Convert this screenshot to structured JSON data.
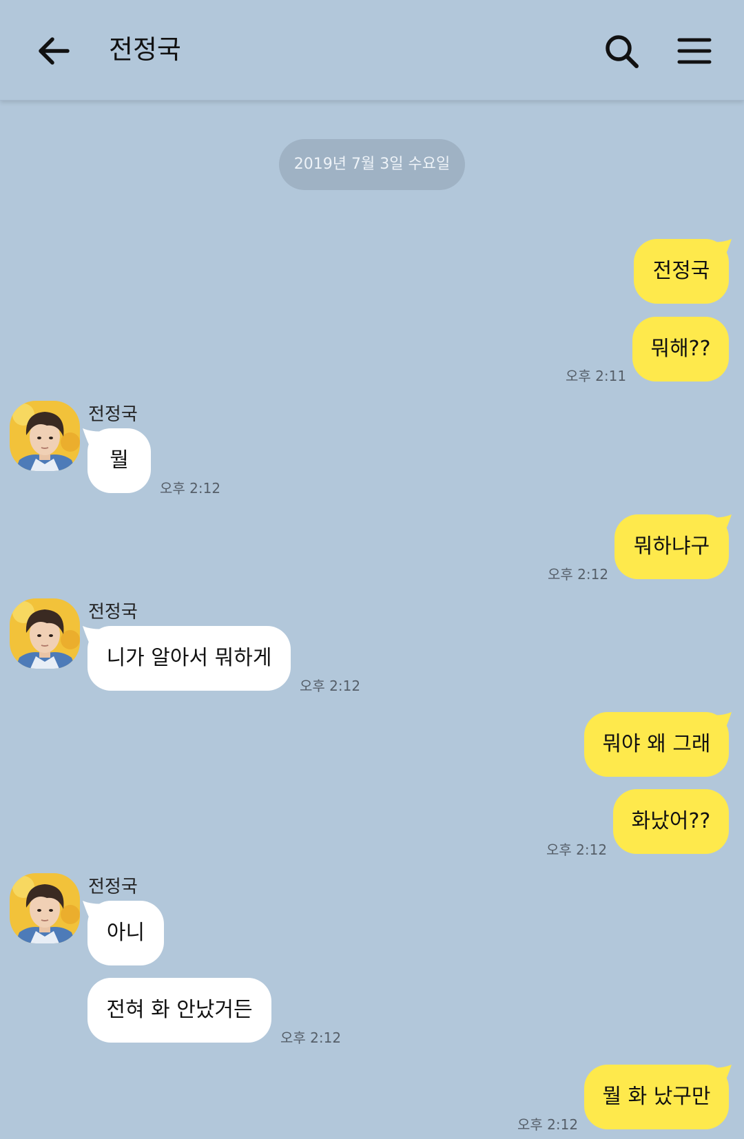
{
  "header": {
    "title": "전정국"
  },
  "icons": {
    "back": "arrow-left-icon",
    "search": "search-icon",
    "menu": "hamburger-menu-icon"
  },
  "colors": {
    "background": "#b2c7da",
    "my_bubble": "#fee94c",
    "their_bubble": "#ffffff",
    "date_pill": "#9fb2c4"
  },
  "date_divider": "2019년 7월 3일 수요일",
  "contact_name": "전정국",
  "messages": [
    {
      "from": "me",
      "text": "전정국"
    },
    {
      "from": "me",
      "text": "뭐해??",
      "time": "오후 2:11"
    },
    {
      "from": "them",
      "sender": "전정국",
      "text": "뭘",
      "time": "오후 2:12"
    },
    {
      "from": "me",
      "text": "뭐하냐구",
      "time": "오후 2:12"
    },
    {
      "from": "them",
      "sender": "전정국",
      "text": "니가 알아서 뭐하게",
      "time": "오후 2:12"
    },
    {
      "from": "me",
      "text": "뭐야 왜 그래"
    },
    {
      "from": "me",
      "text": "화났어??",
      "time": "오후 2:12"
    },
    {
      "from": "them",
      "sender": "전정국",
      "text": "아니"
    },
    {
      "from": "them",
      "text": "전혀 화 안났거든",
      "time": "오후 2:12"
    },
    {
      "from": "me",
      "text": "뭘 화 났구만",
      "time": "오후 2:12"
    }
  ]
}
